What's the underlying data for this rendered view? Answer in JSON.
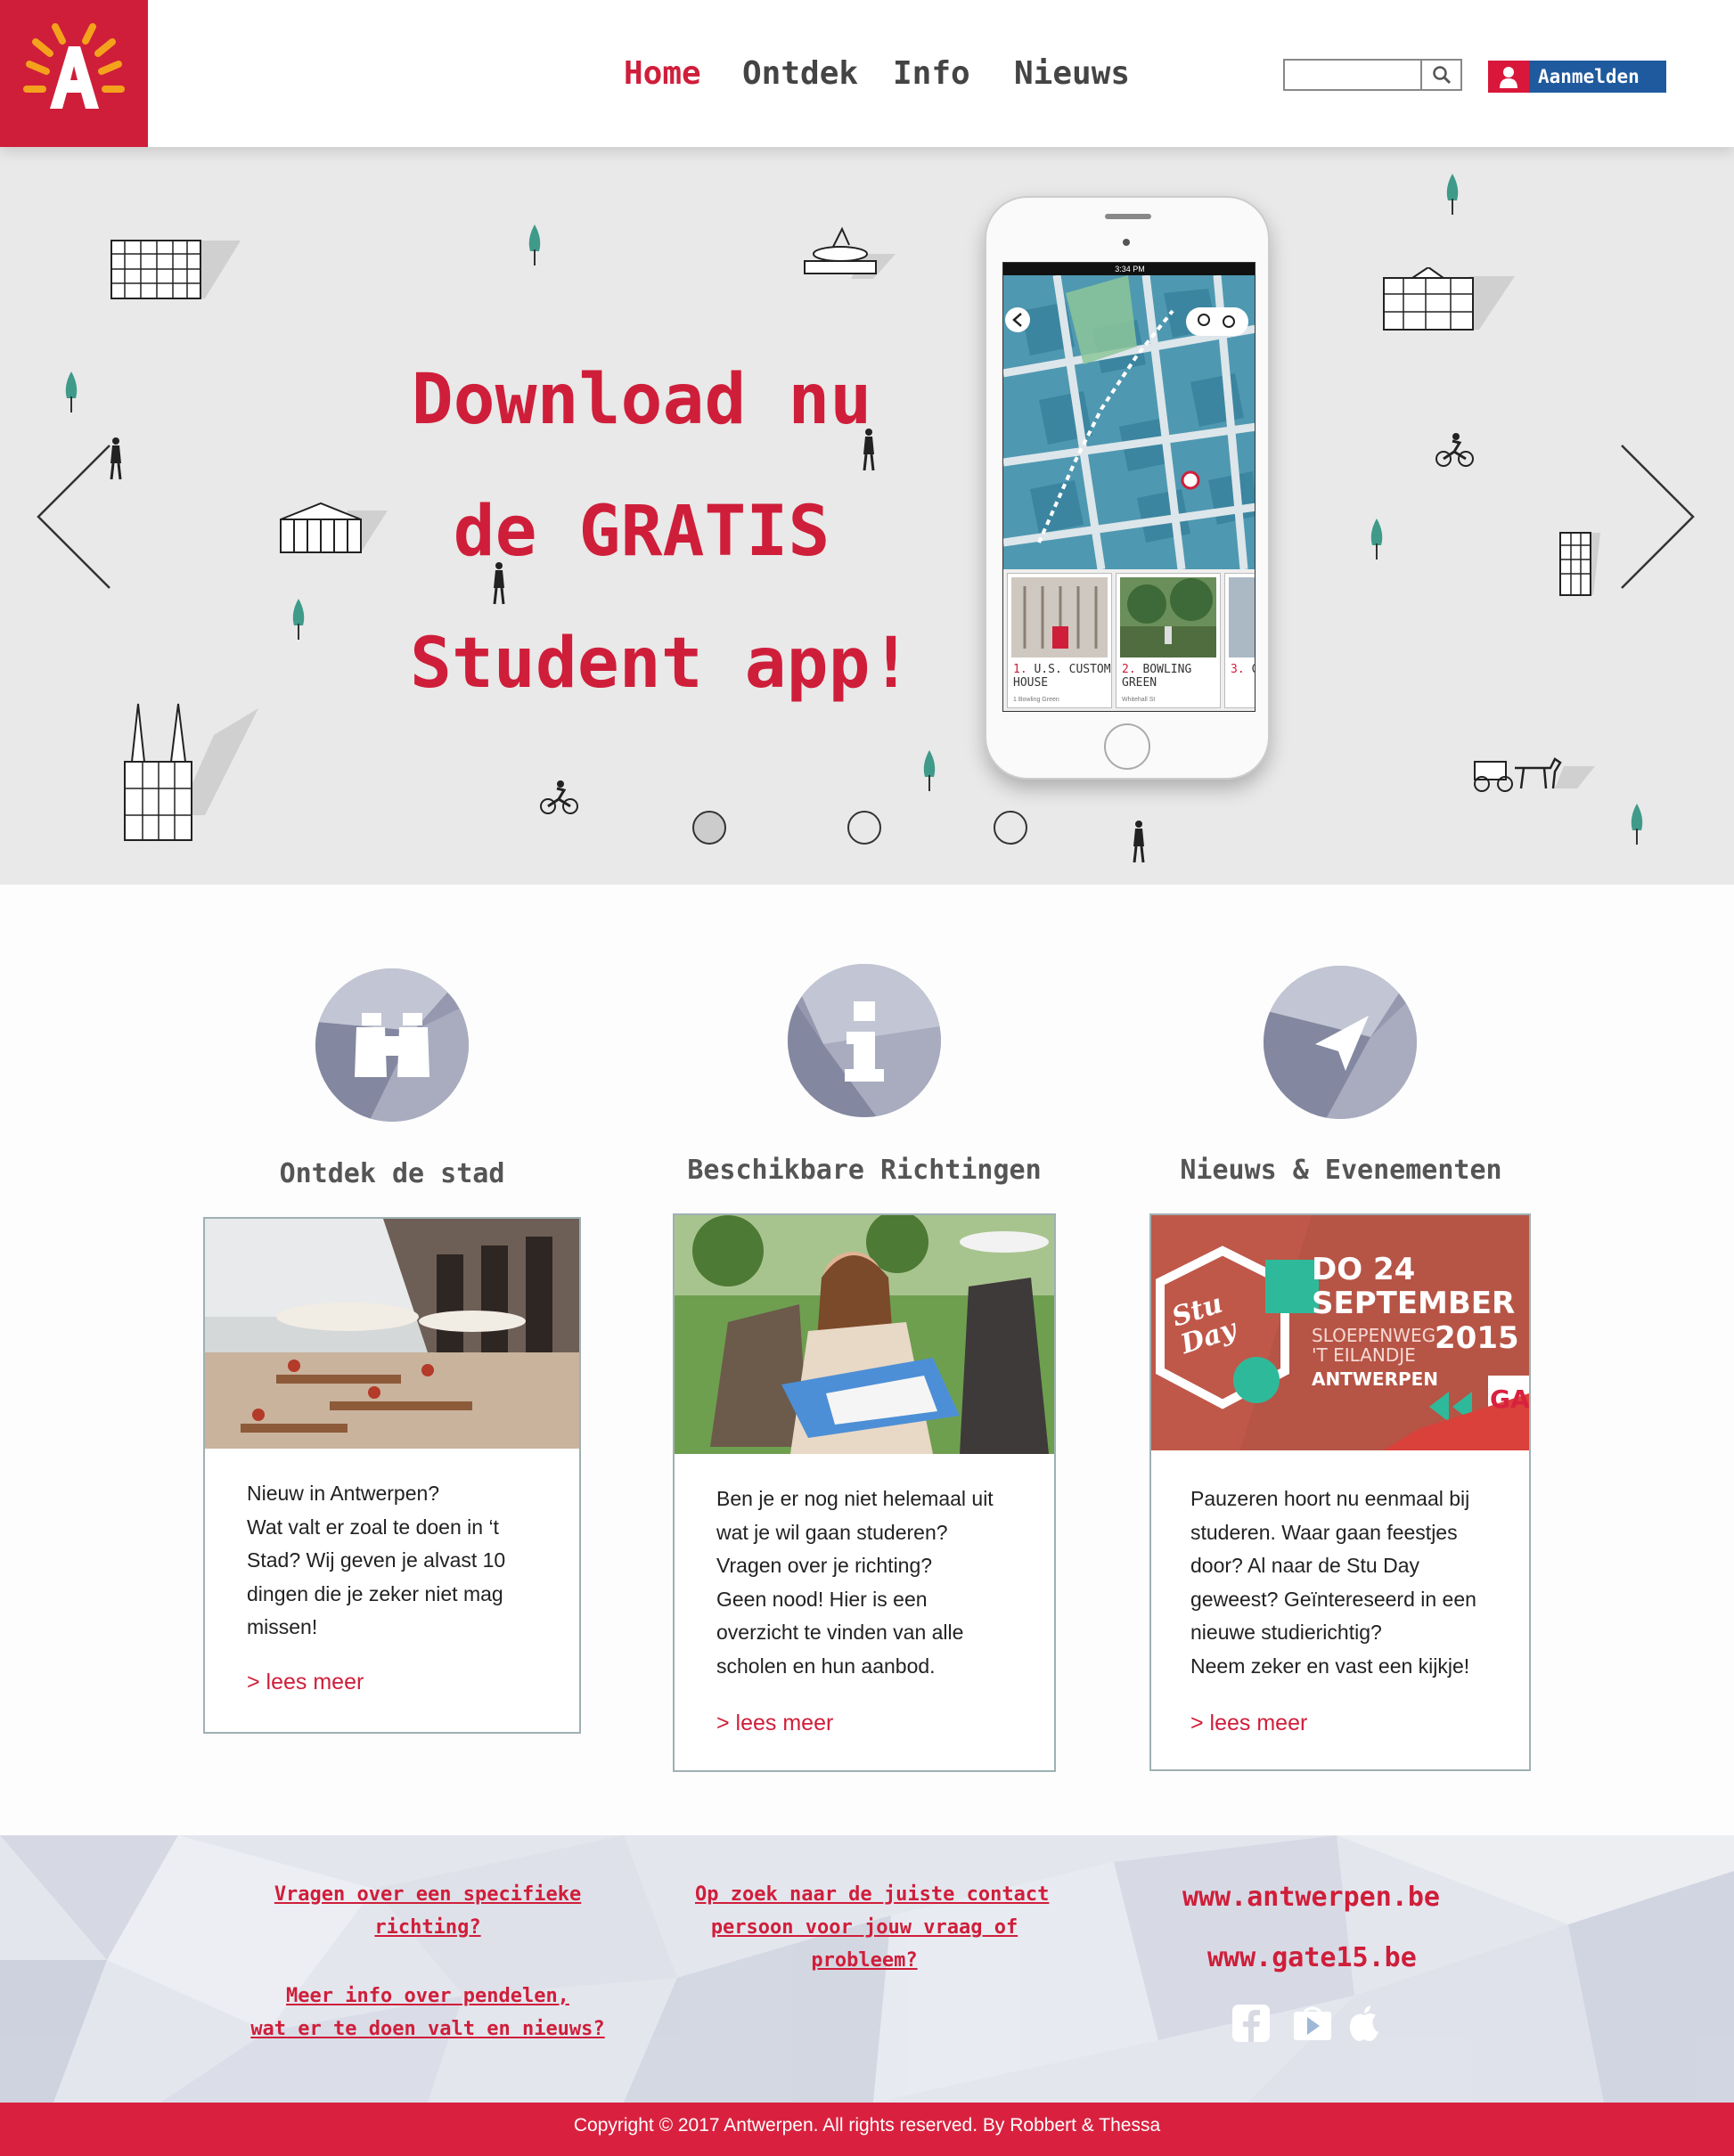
{
  "header": {
    "nav": [
      {
        "label": "Home",
        "active": true
      },
      {
        "label": "Ontdek",
        "active": false
      },
      {
        "label": "Info",
        "active": false
      },
      {
        "label": "Nieuws",
        "active": false
      }
    ],
    "search": {
      "value": "",
      "placeholder": ""
    },
    "login_label": "Aanmelden"
  },
  "hero": {
    "title_lines": [
      "Download nu",
      "de GRATIS",
      "Student app!"
    ],
    "slides_total": 3,
    "slide_active": 1,
    "phone": {
      "status_time": "3:34 PM",
      "cards": [
        {
          "num": "1.",
          "label": "U.S. CUSTOM HOUSE",
          "sub": "1 Bowling Green"
        },
        {
          "num": "2.",
          "label": "BOWLING GREEN",
          "sub": "Whitehall St"
        },
        {
          "num": "3.",
          "label": "C",
          "sub": ""
        }
      ]
    }
  },
  "columns": [
    {
      "icon": "binoculars-icon",
      "title": "Ontdek de stad",
      "text_lines": [
        "Nieuw in Antwerpen?",
        "Wat valt er zoal te doen in ‘t",
        "Stad? Wij geven je alvast 10",
        "dingen die je zeker niet mag",
        "missen!"
      ],
      "link": "> lees meer"
    },
    {
      "icon": "info-icon",
      "title": "Beschikbare Richtingen",
      "text_lines": [
        "Ben je er nog niet helemaal uit",
        "wat je wil gaan studeren?",
        "Vragen over je richting?",
        "Geen nood! Hier is een",
        "overzicht te vinden van alle",
        "scholen en hun aanbod."
      ],
      "link": "> lees meer"
    },
    {
      "icon": "paper-plane-icon",
      "title": "Nieuws & Evenementen",
      "text_lines": [
        "Pauzeren hoort nu eenmaal bij",
        "studeren. Waar gaan feestjes",
        "door? Al naar de Stu Day",
        "geweest? Geïntereseerd in een",
        "nieuwe studierichtig?",
        "Neem zeker en vast een kijkje!"
      ],
      "link": "> lees meer",
      "poster": {
        "logo_line1": "Stu",
        "logo_line2": "Day",
        "date_line1": "DO 24",
        "date_line2": "SEPTEMBER",
        "year": "2015",
        "place_line1": "SLOEPENWEG",
        "place_line2": "'T EILANDJE",
        "city": "ANTWERPEN",
        "sponsor": "GA"
      }
    }
  ],
  "footer": {
    "links": [
      {
        "lines": [
          "Vragen over een specifieke",
          "richting?"
        ]
      },
      {
        "lines": [
          "Meer info over pendelen,",
          "wat er te doen valt en nieuws?"
        ]
      },
      {
        "lines": [
          "Op zoek naar de juiste contact",
          "persoon voor jouw vraag of",
          "probleem?"
        ]
      }
    ],
    "sites": [
      "www.antwerpen.be",
      "www.gate15.be"
    ],
    "social": [
      "facebook-icon",
      "google-play-icon",
      "apple-icon"
    ],
    "copyright": "Copyright © 2017 Antwerpen. All rights reserved. By Robbert & Thessa"
  },
  "colors": {
    "brand_red": "#cf1e3a",
    "login_blue": "#1f5a9e",
    "footer_bar": "#d9213f"
  }
}
